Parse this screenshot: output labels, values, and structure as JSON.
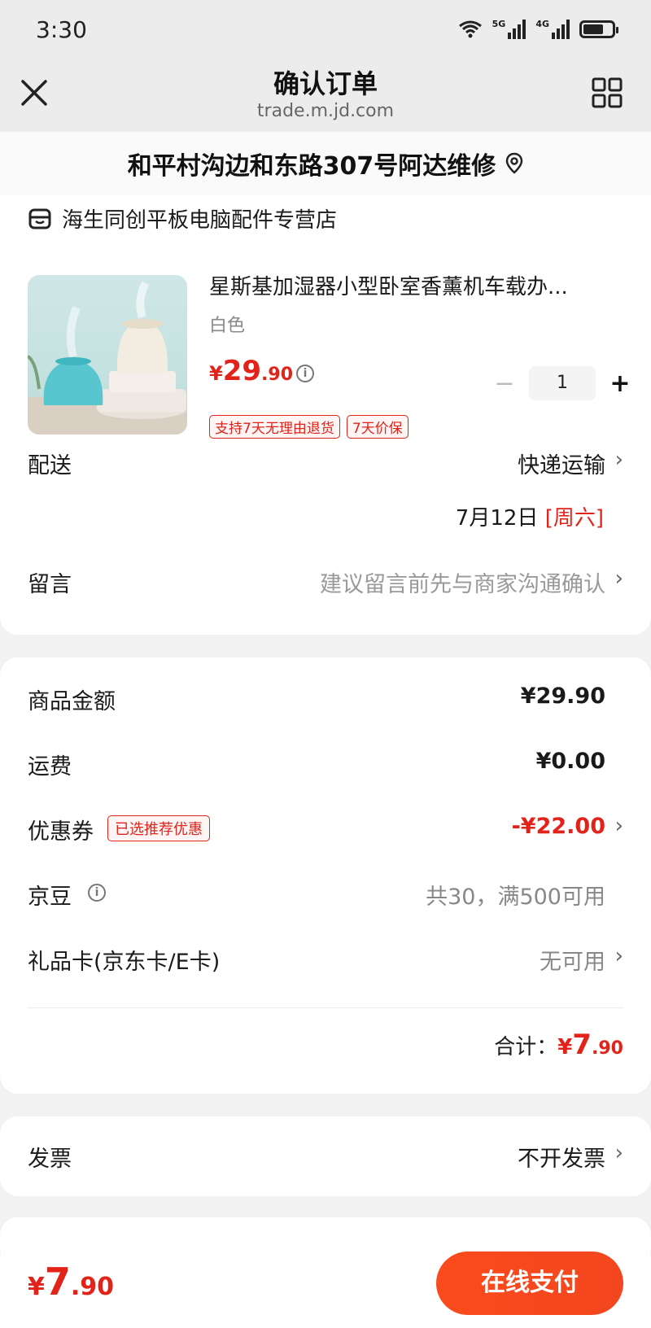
{
  "status_bar": {
    "time": "3:30",
    "sig1_label": "5G",
    "sig2_label": "4G"
  },
  "nav": {
    "title": "确认订单",
    "url": "trade.m.jd.com"
  },
  "address": {
    "text": "和平村沟边和东路307号阿达维修"
  },
  "shop": {
    "name": "海生同创平板电脑配件专营店",
    "product": {
      "title": "星斯基加湿器小型卧室香薰机车载办...",
      "spec": "白色",
      "price_yen": "¥",
      "price_int": "29",
      "price_dec": ".90",
      "quantity": "1",
      "minus": "−",
      "plus": "+",
      "tags": [
        "支持7天无理由退货",
        "7天价保"
      ]
    },
    "delivery": {
      "label": "配送",
      "value": "快递运输",
      "date": "7月12日 ",
      "weekday": "[周六]"
    },
    "message": {
      "label": "留言",
      "placeholder": "建议留言前先与商家沟通确认"
    }
  },
  "fees": {
    "goods": {
      "label": "商品金额",
      "value": "¥29.90"
    },
    "shipping": {
      "label": "运费",
      "value": "¥0.00"
    },
    "coupon": {
      "label": "优惠券",
      "tag": "已选推荐优惠",
      "value": "-¥22.00"
    },
    "jd_beans": {
      "label": "京豆",
      "value": "共30，满500可用"
    },
    "gift_card": {
      "label": "礼品卡(京东卡/E卡)",
      "value": "无可用"
    },
    "total": {
      "label": "合计：",
      "yen": "¥",
      "int": "7",
      "dec": ".90"
    }
  },
  "invoice": {
    "label": "发票",
    "value": "不开发票"
  },
  "bottom": {
    "yen": "¥",
    "int": "7",
    "dec": ".90",
    "pay_label": "在线支付"
  },
  "colors": {
    "accent": "#e2231a",
    "pay_button": "#f3461f"
  }
}
